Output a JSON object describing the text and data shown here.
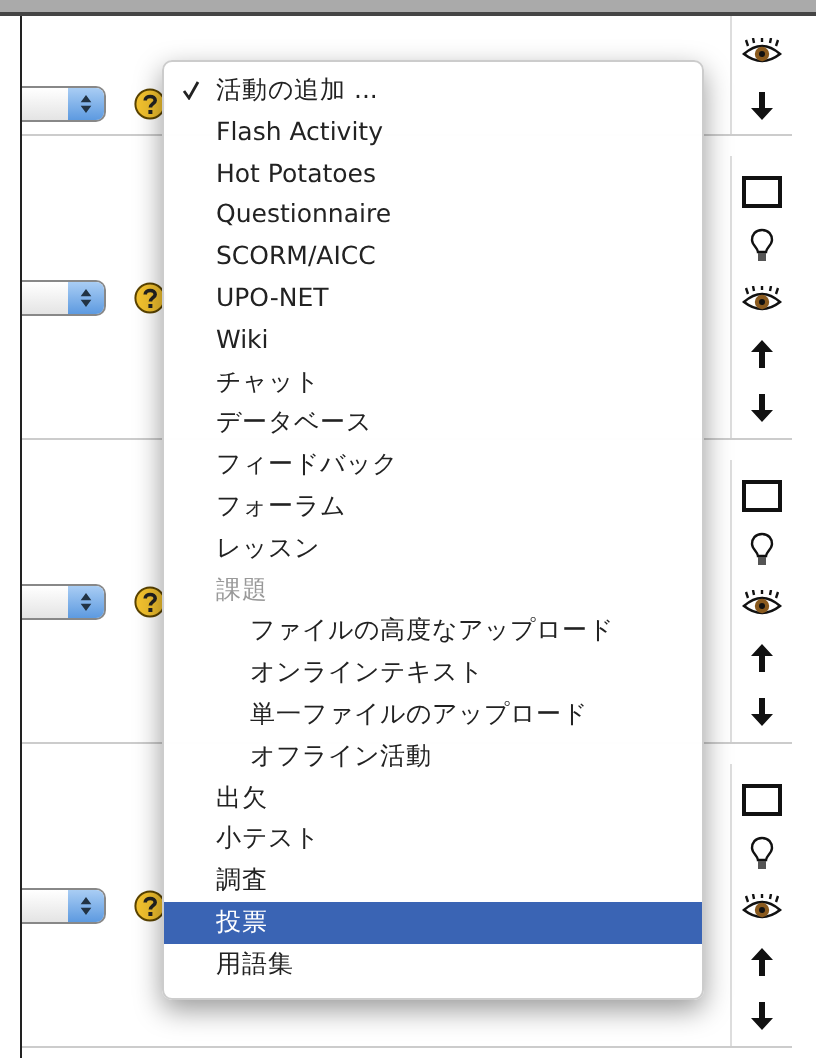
{
  "sections": [
    {
      "kind": "partial"
    },
    {
      "kind": "full"
    },
    {
      "kind": "full"
    },
    {
      "kind": "full"
    }
  ],
  "menu": {
    "items": [
      {
        "label": "活動の追加 ...",
        "checked": true,
        "disabled": false,
        "selected": false
      },
      {
        "label": "Flash Activity",
        "checked": false,
        "disabled": false,
        "selected": false
      },
      {
        "label": "Hot Potatoes",
        "checked": false,
        "disabled": false,
        "selected": false
      },
      {
        "label": "Questionnaire",
        "checked": false,
        "disabled": false,
        "selected": false
      },
      {
        "label": "SCORM/AICC",
        "checked": false,
        "disabled": false,
        "selected": false
      },
      {
        "label": "UPO-NET",
        "checked": false,
        "disabled": false,
        "selected": false
      },
      {
        "label": "Wiki",
        "checked": false,
        "disabled": false,
        "selected": false
      },
      {
        "label": "チャット",
        "checked": false,
        "disabled": false,
        "selected": false
      },
      {
        "label": "データベース",
        "checked": false,
        "disabled": false,
        "selected": false
      },
      {
        "label": "フィードバック",
        "checked": false,
        "disabled": false,
        "selected": false
      },
      {
        "label": "フォーラム",
        "checked": false,
        "disabled": false,
        "selected": false
      },
      {
        "label": "レッスン",
        "checked": false,
        "disabled": false,
        "selected": false
      },
      {
        "label": "課題",
        "checked": false,
        "disabled": true,
        "selected": false,
        "children": [
          {
            "label": "ファイルの高度なアップロード",
            "checked": false,
            "disabled": false,
            "selected": false
          },
          {
            "label": "オンラインテキスト",
            "checked": false,
            "disabled": false,
            "selected": false
          },
          {
            "label": "単一ファイルのアップロード",
            "checked": false,
            "disabled": false,
            "selected": false
          },
          {
            "label": "オフライン活動",
            "checked": false,
            "disabled": false,
            "selected": false
          }
        ]
      },
      {
        "label": "出欠",
        "checked": false,
        "disabled": false,
        "selected": false
      },
      {
        "label": "小テスト",
        "checked": false,
        "disabled": false,
        "selected": false
      },
      {
        "label": "調査",
        "checked": false,
        "disabled": false,
        "selected": false
      },
      {
        "label": "投票",
        "checked": false,
        "disabled": false,
        "selected": true
      },
      {
        "label": "用語集",
        "checked": false,
        "disabled": false,
        "selected": false
      }
    ]
  }
}
